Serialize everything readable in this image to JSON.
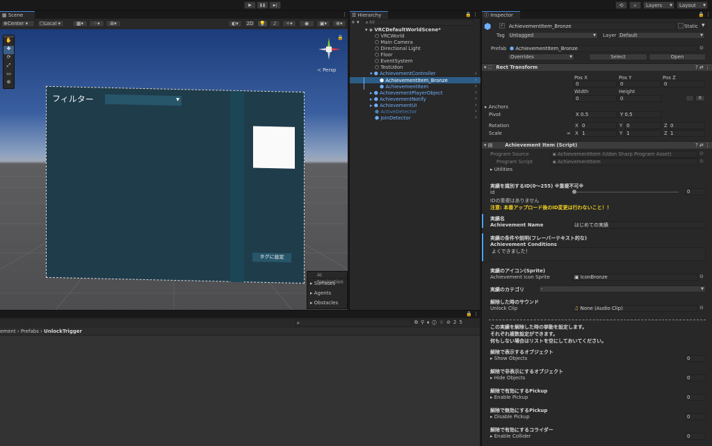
{
  "toolbar": {
    "play": "▶",
    "pause": "❚❚",
    "step": "▶|",
    "layers": "Layers",
    "layout": "Layout"
  },
  "scene": {
    "tab": "Scene",
    "pivot": "Center",
    "space": "Local",
    "mode2d": "2D",
    "persp": "≺ Persp",
    "filter_label": "フィルター",
    "tag_button": "タグに設定",
    "ai_nav": {
      "title": "AI Navigation",
      "items": [
        "Surfaces",
        "Agents",
        "Obstacles"
      ]
    }
  },
  "project": {
    "breadcrumb": [
      "ement",
      "Prefabs",
      "UnlockTrigger"
    ],
    "count": "25"
  },
  "hierarchy": {
    "tab": "Hierarchy",
    "search": "All",
    "scene": "VRCDefaultWorldScene*",
    "items": [
      "VRCWorld",
      "Main Camera",
      "Directional Light",
      "Floor",
      "EventSystem",
      "TestUdon",
      "AchievementController",
      "AchievementItem_Bronze",
      "AchievementItem",
      "AchievementPlayerObject",
      "AchievementNotify",
      "AchievementUI",
      "ActiveDetector",
      "JoinDetector"
    ]
  },
  "inspector": {
    "tab": "Inspector",
    "name": "AchievementItem_Bronze",
    "static": "Static",
    "tag_label": "Tag",
    "tag": "Untagged",
    "layer_label": "Layer",
    "layer": "Default",
    "prefab_label": "Prefab",
    "prefab": "AchievementItem_Bronze",
    "overrides": "Overrides",
    "select": "Select",
    "open": "Open",
    "rect": {
      "title": "Rect Transform",
      "posx": "Pos X",
      "posy": "Pos Y",
      "posz": "Pos Z",
      "vx": "0",
      "vy": "0",
      "vz": "0",
      "width": "Width",
      "height": "Height",
      "vw": "0",
      "vh": "0",
      "btn_r": "R",
      "anchors": "Anchors",
      "pivot": "Pivot",
      "pivx": "X 0.5",
      "pivy": "Y 0.5",
      "rotation": "Rotation",
      "rx": "0",
      "ry": "0",
      "rz": "0",
      "scale": "Scale",
      "sx": "1",
      "sy": "1",
      "sz": "1",
      "X": "X",
      "Y": "Y",
      "Z": "Z"
    },
    "script": {
      "title": "Achievement Item (Script)",
      "src_label": "Program Source",
      "src": "AchievementItem (Udon Sharp Program Asset)",
      "prog_label": "Program Script",
      "prog": "AchievementItem",
      "utilities": "Utilities"
    },
    "fields": {
      "id_header": "実績を識別するID(0〜255) ※重複不可※",
      "id_label": "Id",
      "id_value": "0",
      "id_note": "IDの重複はありません",
      "id_warn": "注意: 本番アップロード後のID変更は行わないこと！！",
      "name_header": "実績名",
      "name_label": "Achievement Name",
      "name_value": "はじめての実績",
      "cond_header": "実績の条件や説明(フレーバーテキスト的な)",
      "cond_label": "Achievement Conditions",
      "cond_value": "よくできました！",
      "icon_header": "実績のアイコン(Sprite)",
      "icon_label": "Achievement Icon Sprite",
      "icon_value": "IconBronze",
      "cat_header": "実績のカテゴリ",
      "cat_value": "-",
      "sound_header": "解除した時のサウンド",
      "sound_label": "Unlock Clip",
      "sound_value": "None (Audio Clip)",
      "desc": [
        "この実績を解除した時の挙動を設定します。",
        "それぞれ複数設定ができます。",
        "何もしない場合はリストを空にしておいてください。"
      ],
      "lists": [
        {
          "header": "解除で表示するオブジェクト",
          "label": "Show Objects",
          "count": "0"
        },
        {
          "header": "解除で非表示にするオブジェクト",
          "label": "Hide Objects",
          "count": "0"
        },
        {
          "header": "解除で有効にするPickup",
          "label": "Enable Pickup",
          "count": "0"
        },
        {
          "header": "解除で無効にするPickup",
          "label": "Disable Pickup",
          "count": "0"
        },
        {
          "header": "解除で有効にするコライダー",
          "label": "Enable Collider",
          "count": "0"
        }
      ]
    },
    "colors": {
      "warn": "#f0d020",
      "accent": "#4aa3ff",
      "selected": "#2c5d87"
    }
  }
}
